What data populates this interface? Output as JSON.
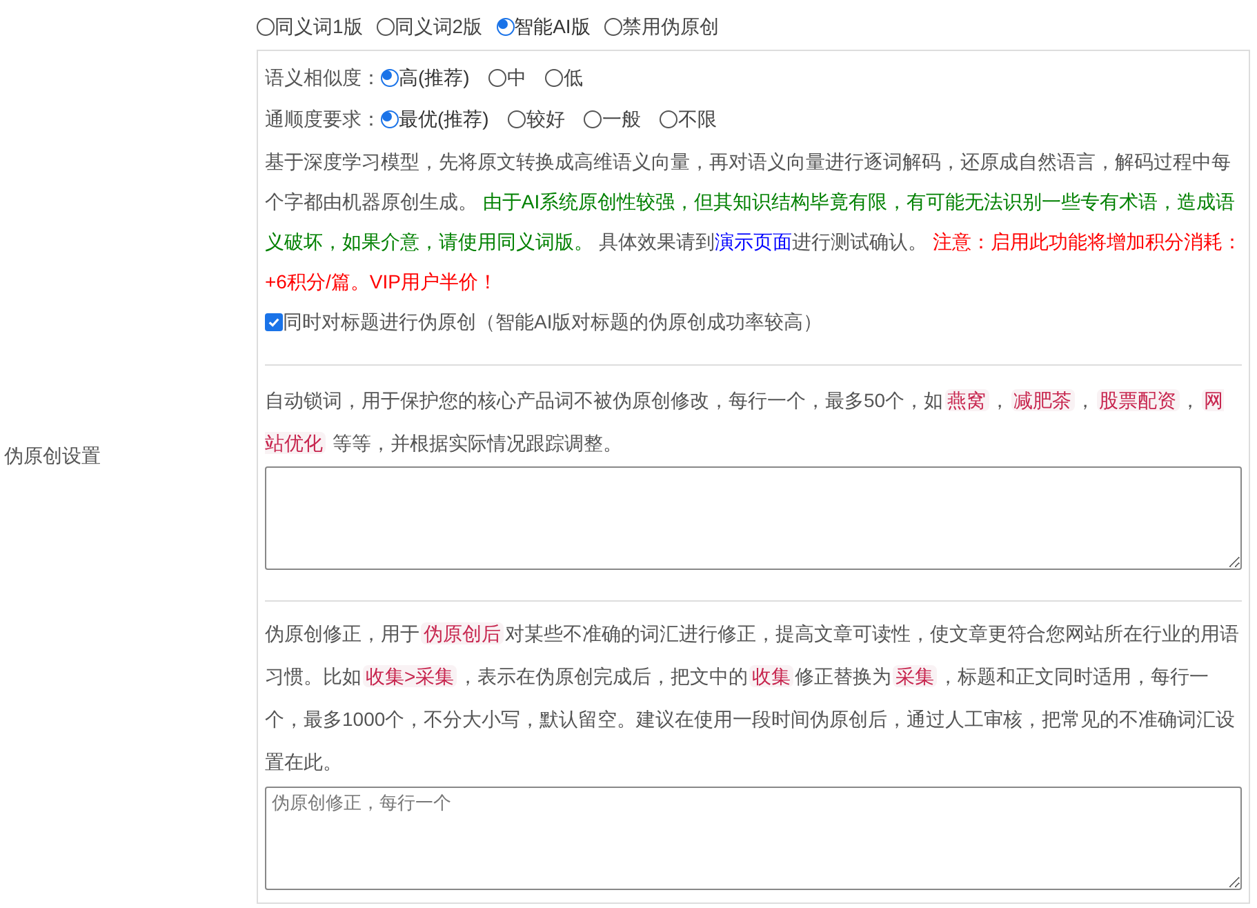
{
  "section_label": "伪原创设置",
  "mode_options": [
    {
      "label": "同义词1版",
      "selected": false
    },
    {
      "label": "同义词2版",
      "selected": false
    },
    {
      "label": "智能AI版",
      "selected": true
    },
    {
      "label": "禁用伪原创",
      "selected": false
    }
  ],
  "similarity": {
    "label": "语义相似度：",
    "options": [
      {
        "label": "高(推荐)",
        "selected": true
      },
      {
        "label": "中",
        "selected": false
      },
      {
        "label": "低",
        "selected": false
      }
    ]
  },
  "fluency": {
    "label": "通顺度要求：",
    "options": [
      {
        "label": "最优(推荐)",
        "selected": true
      },
      {
        "label": "较好",
        "selected": false
      },
      {
        "label": "一般",
        "selected": false
      },
      {
        "label": "不限",
        "selected": false
      }
    ]
  },
  "ai_description": [
    {
      "kind": "plain",
      "text": "基于深度学习模型，先将原文转换成高维语义向量，再对语义向量进行逐词解码，还原成自然语言，解码过程中每个字都由机器原创生成。 "
    },
    {
      "kind": "green",
      "text": "由于AI系统原创性较强，但其知识结构毕竟有限，有可能无法识别一些专有术语，造成语义破坏，如果介意，请使用同义词版。"
    },
    {
      "kind": "plain",
      "text": " 具体效果请到"
    },
    {
      "kind": "link",
      "text": "演示页面"
    },
    {
      "kind": "plain",
      "text": "进行测试确认。 "
    },
    {
      "kind": "red",
      "text": "注意：启用此功能将增加积分消耗：+6积分/篇。VIP用户半价！"
    }
  ],
  "title_option": {
    "label": "同时对标题进行伪原创（智能AI版对标题的伪原创成功率较高）",
    "checked": true
  },
  "lock_words": {
    "description": [
      {
        "kind": "plain",
        "text": "自动锁词，用于保护您的核心产品词不被伪原创修改，每行一个，最多50个，如"
      },
      {
        "kind": "tag",
        "text": "燕窝"
      },
      {
        "kind": "plain",
        "text": "，"
      },
      {
        "kind": "tag",
        "text": "减肥茶"
      },
      {
        "kind": "plain",
        "text": "，"
      },
      {
        "kind": "tag",
        "text": "股票配资"
      },
      {
        "kind": "plain",
        "text": "，"
      },
      {
        "kind": "tag",
        "text": "网站优化"
      },
      {
        "kind": "plain",
        "text": " 等等，并根据实际情况跟踪调整。"
      }
    ]
  },
  "corrections": {
    "description": [
      {
        "kind": "plain",
        "text": "伪原创修正，用于"
      },
      {
        "kind": "tag",
        "text": "伪原创后"
      },
      {
        "kind": "plain",
        "text": "对某些不准确的词汇进行修正，提高文章可读性，使文章更符合您网站所在行业的用语习惯。比如"
      },
      {
        "kind": "tag",
        "text": "收集>采集"
      },
      {
        "kind": "plain",
        "text": "，表示在伪原创完成后，把文中的"
      },
      {
        "kind": "tag",
        "text": "收集"
      },
      {
        "kind": "plain",
        "text": "修正替换为"
      },
      {
        "kind": "tag",
        "text": "采集"
      },
      {
        "kind": "plain",
        "text": "，标题和正文同时适用，每行一个，最多1000个，不分大小写，默认留空。建议在使用一段时间伪原创后，通过人工审核，把常见的不准确词汇设置在此。"
      }
    ],
    "placeholder": "伪原创修正，每行一个"
  }
}
